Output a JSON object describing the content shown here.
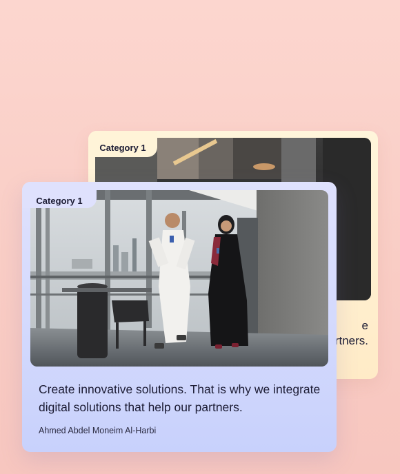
{
  "back_card": {
    "category": "Category 1",
    "text_fragment_1": "e",
    "text_fragment_2": "rtners."
  },
  "front_card": {
    "category": "Category 1",
    "quote": "Create innovative solutions. That is why we integrate digital solutions that help our partners.",
    "author": "Ahmed Abdel Moneim Al-Harbi"
  },
  "colors": {
    "background": "#fcd6cf",
    "back_card": "#fff5db",
    "front_card": "#d3d9fd",
    "text": "#1c1c34"
  }
}
